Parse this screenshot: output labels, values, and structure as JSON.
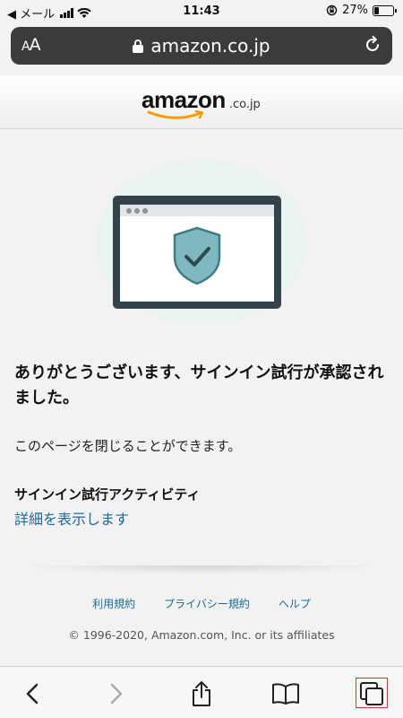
{
  "status_bar": {
    "back_app": "◀ メール",
    "time": "11:43",
    "battery": "27%",
    "battery_level": 0.27
  },
  "address_bar": {
    "text_size_label": "AA",
    "url": "amazon.co.jp"
  },
  "header": {
    "logo_word": "amazon",
    "logo_tld": ".co.jp"
  },
  "content": {
    "heading": "ありがとうございます、サインイン試行が承認されました。",
    "subtext": "このページを閉じることができます。",
    "activity_label": "サインイン試行アクティビティ",
    "details_link": "詳細を表示します"
  },
  "footer": {
    "links": [
      "利用規約",
      "プライバシー規約",
      "ヘルプ"
    ],
    "copyright": "© 1996-2020, Amazon.com, Inc. or its affiliates"
  },
  "colors": {
    "link": "#1a6a9a",
    "shield": "#7fb8bf",
    "logo_smile": "#f90"
  }
}
